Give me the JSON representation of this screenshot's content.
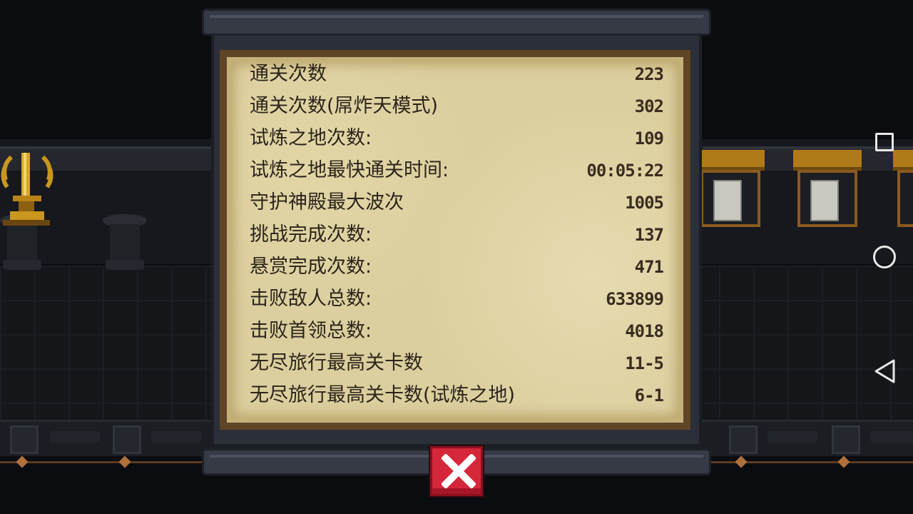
{
  "stats_panel": {
    "rows": [
      {
        "label": "通关次数",
        "value": "223"
      },
      {
        "label": "通关次数(屌炸天模式)",
        "value": "302"
      },
      {
        "label": "试炼之地次数:",
        "value": "109"
      },
      {
        "label": "试炼之地最快通关时间:",
        "value": "00:05:22"
      },
      {
        "label": "守护神殿最大波次",
        "value": "1005"
      },
      {
        "label": "挑战完成次数:",
        "value": "137"
      },
      {
        "label": "悬赏完成次数:",
        "value": "471"
      },
      {
        "label": "击败敌人总数:",
        "value": "633899"
      },
      {
        "label": "击败首领总数:",
        "value": "4018"
      },
      {
        "label": "无尽旅行最高关卡数",
        "value": "11-5"
      },
      {
        "label": "无尽旅行最高关卡数(试炼之地)",
        "value": "6-1"
      }
    ]
  },
  "controls": {
    "close_icon": "close-x-icon",
    "nav": [
      "recent-apps-icon",
      "home-icon",
      "back-icon"
    ]
  },
  "colors": {
    "parchment": "#dccf9f",
    "close_button": "#d4283a",
    "text": "#2c241a"
  }
}
